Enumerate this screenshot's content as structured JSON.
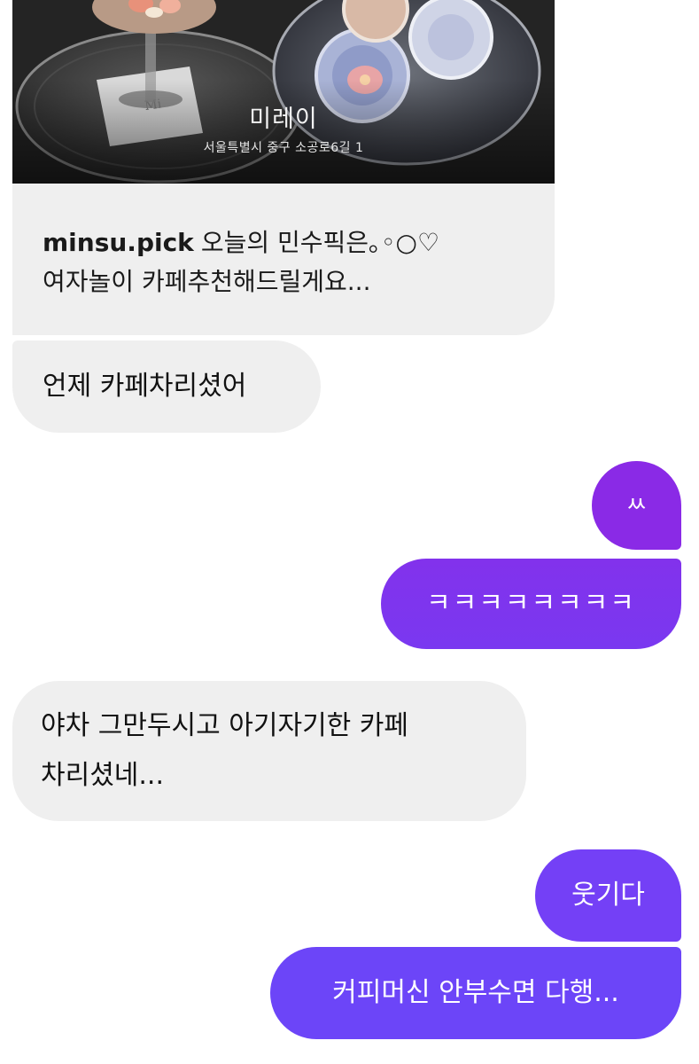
{
  "shared_post": {
    "place_name": "미레이",
    "place_address": "서울특별시 중구 소공로6길 1",
    "username": "minsu.pick",
    "caption_line1": "오늘의 민수픽은｡◦○♡",
    "caption_line2": "여자놀이 카페추천해드릴게요..."
  },
  "messages": [
    {
      "direction": "incoming",
      "text": "언제 카페차리셨어"
    },
    {
      "direction": "outgoing",
      "text": "ㅆ"
    },
    {
      "direction": "outgoing",
      "text": "ㅋㅋㅋㅋㅋㅋㅋㅋ"
    },
    {
      "direction": "incoming",
      "text_line1": "야차 그만두시고 아기자기한 카페",
      "text_line2": "차리셨네..."
    },
    {
      "direction": "outgoing",
      "text": "웃기다"
    },
    {
      "direction": "outgoing",
      "text": "커피머신 안부수면 다행..."
    }
  ],
  "colors": {
    "incoming_bubble": "#efefef",
    "outgoing_top": "#8a2be8",
    "outgoing_bottom": "#6f43f8"
  }
}
